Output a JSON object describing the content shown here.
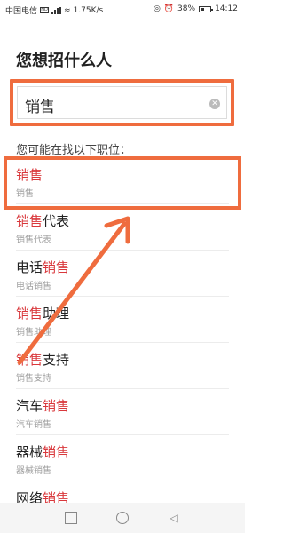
{
  "status_bar": {
    "carrier": "中国电信",
    "speed": "1.75K/s",
    "battery": "38%",
    "time": "14:12"
  },
  "page": {
    "title": "您想招什么人"
  },
  "search": {
    "value": "销售"
  },
  "suggestions": {
    "hint": "您可能在找以下职位：",
    "items": [
      {
        "pre": "",
        "hl": "销售",
        "post": "",
        "sub": "销售"
      },
      {
        "pre": "",
        "hl": "销售",
        "post": "代表",
        "sub": "销售代表"
      },
      {
        "pre": "电话",
        "hl": "销售",
        "post": "",
        "sub": "电话销售"
      },
      {
        "pre": "",
        "hl": "销售",
        "post": "助理",
        "sub": "销售助理"
      },
      {
        "pre": "",
        "hl": "销售",
        "post": "支持",
        "sub": "销售支持"
      },
      {
        "pre": "汽车",
        "hl": "销售",
        "post": "",
        "sub": "汽车销售"
      },
      {
        "pre": "器械",
        "hl": "销售",
        "post": "",
        "sub": "器械销售"
      },
      {
        "pre": "网络",
        "hl": "销售",
        "post": "",
        "sub": ""
      }
    ]
  },
  "colors": {
    "annotation": "#ef6c3e",
    "keyword_highlight": "#d9383c"
  },
  "icons": {
    "clear": "clear-circle-icon",
    "nav_recent": "square-icon",
    "nav_home": "circle-icon",
    "nav_back": "triangle-back-icon"
  }
}
